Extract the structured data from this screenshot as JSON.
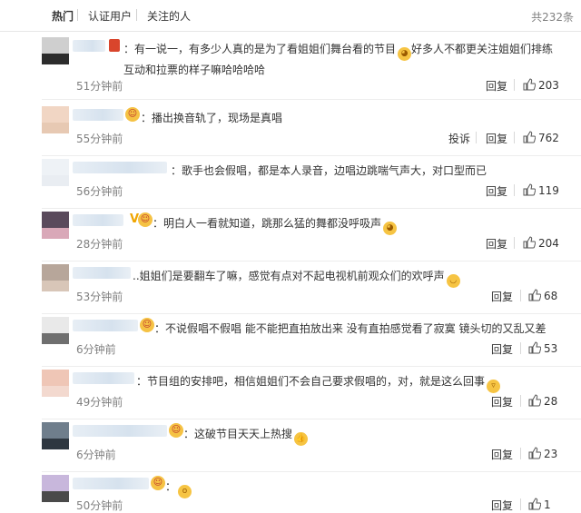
{
  "tabs": {
    "hot": "热门",
    "verified": "认证用户",
    "following": "关注的人",
    "total": "共232条"
  },
  "comments": [
    {
      "text": "：有一说一，有多少人真的是为了看姐姐们舞台看的节目",
      "text2": "好多人不都更关注姐姐们排练互动和拉票的样子嘛哈哈哈哈",
      "time": "51分钟前",
      "reply": "回复",
      "likes": "203"
    },
    {
      "text": "：播出换音轨了，现场是真唱",
      "time": "55分钟前",
      "report": "投诉",
      "reply": "回复",
      "likes": "762"
    },
    {
      "text": "：歌手也会假唱，都是本人录音，边唱边跳喘气声大，对口型而已",
      "time": "56分钟前",
      "reply": "回复",
      "likes": "119"
    },
    {
      "text": "：明白人一看就知道，跳那么猛的舞都没呼吸声",
      "time": "28分钟前",
      "reply": "回复",
      "likes": "204"
    },
    {
      "text": "..姐姐们是要翻车了嘛，感觉有点对不起电视机前观众们的欢呼声",
      "time": "53分钟前",
      "reply": "回复",
      "likes": "68"
    },
    {
      "text": "：不说假唱不假唱 能不能把直拍放出来 没有直拍感觉看了寂寞 镜头切的又乱又差",
      "time": "6分钟前",
      "reply": "回复",
      "likes": "53"
    },
    {
      "text": "：节目组的安排吧，相信姐姐们不会自己要求假唱的，对，就是这么回事",
      "time": "49分钟前",
      "reply": "回复",
      "likes": "28"
    },
    {
      "text": "：这破节目天天上热搜",
      "time": "6分钟前",
      "reply": "回复",
      "likes": "23"
    },
    {
      "text": "：",
      "time": "50分钟前",
      "reply": "回复",
      "likes": "1"
    }
  ],
  "colors": {
    "accent": "#eb7350",
    "link": "#333333",
    "muted": "#808080"
  }
}
